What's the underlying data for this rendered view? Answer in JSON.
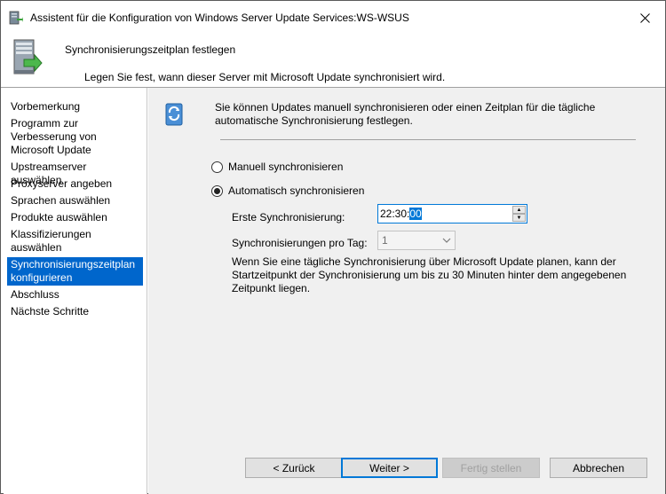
{
  "window": {
    "title": "Assistent für die Konfiguration von Windows Server Update Services:WS-WSUS",
    "close_glyph": "✕"
  },
  "header": {
    "title": "Synchronisierungszeitplan festlegen",
    "description": "Legen Sie fest, wann dieser Server mit Microsoft Update synchronisiert wird.",
    "icon": "server-update-icon"
  },
  "nav": {
    "items": [
      {
        "label": "Vorbemerkung"
      },
      {
        "label": "Programm zur Verbesserung von Microsoft Update"
      },
      {
        "label": "Upstreamserver auswählen"
      },
      {
        "label": "Proxyserver angeben"
      },
      {
        "label": "Sprachen auswählen"
      },
      {
        "label": "Produkte auswählen"
      },
      {
        "label": "Klassifizierungen auswählen"
      },
      {
        "label": "Synchronisierungszeitplan konfigurieren"
      },
      {
        "label": "Abschluss"
      },
      {
        "label": "Nächste Schritte"
      }
    ],
    "selected_index": 7
  },
  "content": {
    "intro": "Sie können Updates manuell synchronisieren oder einen Zeitplan für die tägliche automatische Synchronisierung festlegen.",
    "radio_manual": "Manuell synchronisieren",
    "radio_auto": "Automatisch synchronisieren",
    "selected_option": "auto",
    "first_sync_label": "Erste Synchronisierung:",
    "first_sync_value_prefix": "22:30:",
    "first_sync_value_selected": "00",
    "per_day_label": "Synchronisierungen pro Tag:",
    "per_day_value": "1",
    "info": "Wenn Sie eine tägliche Synchronisierung über Microsoft Update planen, kann der Startzeitpunkt der Synchronisierung um bis zu 30 Minuten hinter dem angegebenen Zeitpunkt liegen."
  },
  "buttons": {
    "back": "< Zurück",
    "next": "Weiter >",
    "finish": "Fertig stellen",
    "cancel": "Abbrechen"
  },
  "colors": {
    "selection": "#0066cc",
    "focus": "#0078d7",
    "content_bg": "#f0f0f0"
  }
}
